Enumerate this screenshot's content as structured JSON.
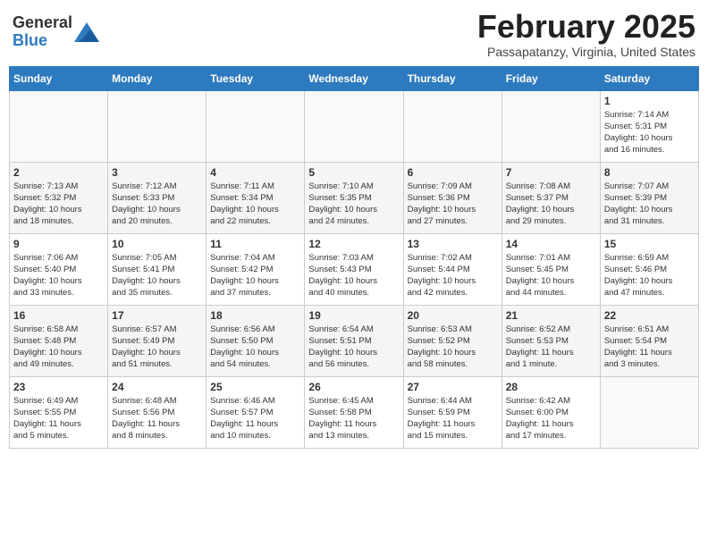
{
  "header": {
    "logo_general": "General",
    "logo_blue": "Blue",
    "title": "February 2025",
    "subtitle": "Passapatanzy, Virginia, United States"
  },
  "days_of_week": [
    "Sunday",
    "Monday",
    "Tuesday",
    "Wednesday",
    "Thursday",
    "Friday",
    "Saturday"
  ],
  "weeks": [
    [
      {
        "day": "",
        "info": ""
      },
      {
        "day": "",
        "info": ""
      },
      {
        "day": "",
        "info": ""
      },
      {
        "day": "",
        "info": ""
      },
      {
        "day": "",
        "info": ""
      },
      {
        "day": "",
        "info": ""
      },
      {
        "day": "1",
        "info": "Sunrise: 7:14 AM\nSunset: 5:31 PM\nDaylight: 10 hours\nand 16 minutes."
      }
    ],
    [
      {
        "day": "2",
        "info": "Sunrise: 7:13 AM\nSunset: 5:32 PM\nDaylight: 10 hours\nand 18 minutes."
      },
      {
        "day": "3",
        "info": "Sunrise: 7:12 AM\nSunset: 5:33 PM\nDaylight: 10 hours\nand 20 minutes."
      },
      {
        "day": "4",
        "info": "Sunrise: 7:11 AM\nSunset: 5:34 PM\nDaylight: 10 hours\nand 22 minutes."
      },
      {
        "day": "5",
        "info": "Sunrise: 7:10 AM\nSunset: 5:35 PM\nDaylight: 10 hours\nand 24 minutes."
      },
      {
        "day": "6",
        "info": "Sunrise: 7:09 AM\nSunset: 5:36 PM\nDaylight: 10 hours\nand 27 minutes."
      },
      {
        "day": "7",
        "info": "Sunrise: 7:08 AM\nSunset: 5:37 PM\nDaylight: 10 hours\nand 29 minutes."
      },
      {
        "day": "8",
        "info": "Sunrise: 7:07 AM\nSunset: 5:39 PM\nDaylight: 10 hours\nand 31 minutes."
      }
    ],
    [
      {
        "day": "9",
        "info": "Sunrise: 7:06 AM\nSunset: 5:40 PM\nDaylight: 10 hours\nand 33 minutes."
      },
      {
        "day": "10",
        "info": "Sunrise: 7:05 AM\nSunset: 5:41 PM\nDaylight: 10 hours\nand 35 minutes."
      },
      {
        "day": "11",
        "info": "Sunrise: 7:04 AM\nSunset: 5:42 PM\nDaylight: 10 hours\nand 37 minutes."
      },
      {
        "day": "12",
        "info": "Sunrise: 7:03 AM\nSunset: 5:43 PM\nDaylight: 10 hours\nand 40 minutes."
      },
      {
        "day": "13",
        "info": "Sunrise: 7:02 AM\nSunset: 5:44 PM\nDaylight: 10 hours\nand 42 minutes."
      },
      {
        "day": "14",
        "info": "Sunrise: 7:01 AM\nSunset: 5:45 PM\nDaylight: 10 hours\nand 44 minutes."
      },
      {
        "day": "15",
        "info": "Sunrise: 6:59 AM\nSunset: 5:46 PM\nDaylight: 10 hours\nand 47 minutes."
      }
    ],
    [
      {
        "day": "16",
        "info": "Sunrise: 6:58 AM\nSunset: 5:48 PM\nDaylight: 10 hours\nand 49 minutes."
      },
      {
        "day": "17",
        "info": "Sunrise: 6:57 AM\nSunset: 5:49 PM\nDaylight: 10 hours\nand 51 minutes."
      },
      {
        "day": "18",
        "info": "Sunrise: 6:56 AM\nSunset: 5:50 PM\nDaylight: 10 hours\nand 54 minutes."
      },
      {
        "day": "19",
        "info": "Sunrise: 6:54 AM\nSunset: 5:51 PM\nDaylight: 10 hours\nand 56 minutes."
      },
      {
        "day": "20",
        "info": "Sunrise: 6:53 AM\nSunset: 5:52 PM\nDaylight: 10 hours\nand 58 minutes."
      },
      {
        "day": "21",
        "info": "Sunrise: 6:52 AM\nSunset: 5:53 PM\nDaylight: 11 hours\nand 1 minute."
      },
      {
        "day": "22",
        "info": "Sunrise: 6:51 AM\nSunset: 5:54 PM\nDaylight: 11 hours\nand 3 minutes."
      }
    ],
    [
      {
        "day": "23",
        "info": "Sunrise: 6:49 AM\nSunset: 5:55 PM\nDaylight: 11 hours\nand 5 minutes."
      },
      {
        "day": "24",
        "info": "Sunrise: 6:48 AM\nSunset: 5:56 PM\nDaylight: 11 hours\nand 8 minutes."
      },
      {
        "day": "25",
        "info": "Sunrise: 6:46 AM\nSunset: 5:57 PM\nDaylight: 11 hours\nand 10 minutes."
      },
      {
        "day": "26",
        "info": "Sunrise: 6:45 AM\nSunset: 5:58 PM\nDaylight: 11 hours\nand 13 minutes."
      },
      {
        "day": "27",
        "info": "Sunrise: 6:44 AM\nSunset: 5:59 PM\nDaylight: 11 hours\nand 15 minutes."
      },
      {
        "day": "28",
        "info": "Sunrise: 6:42 AM\nSunset: 6:00 PM\nDaylight: 11 hours\nand 17 minutes."
      },
      {
        "day": "",
        "info": ""
      }
    ]
  ]
}
